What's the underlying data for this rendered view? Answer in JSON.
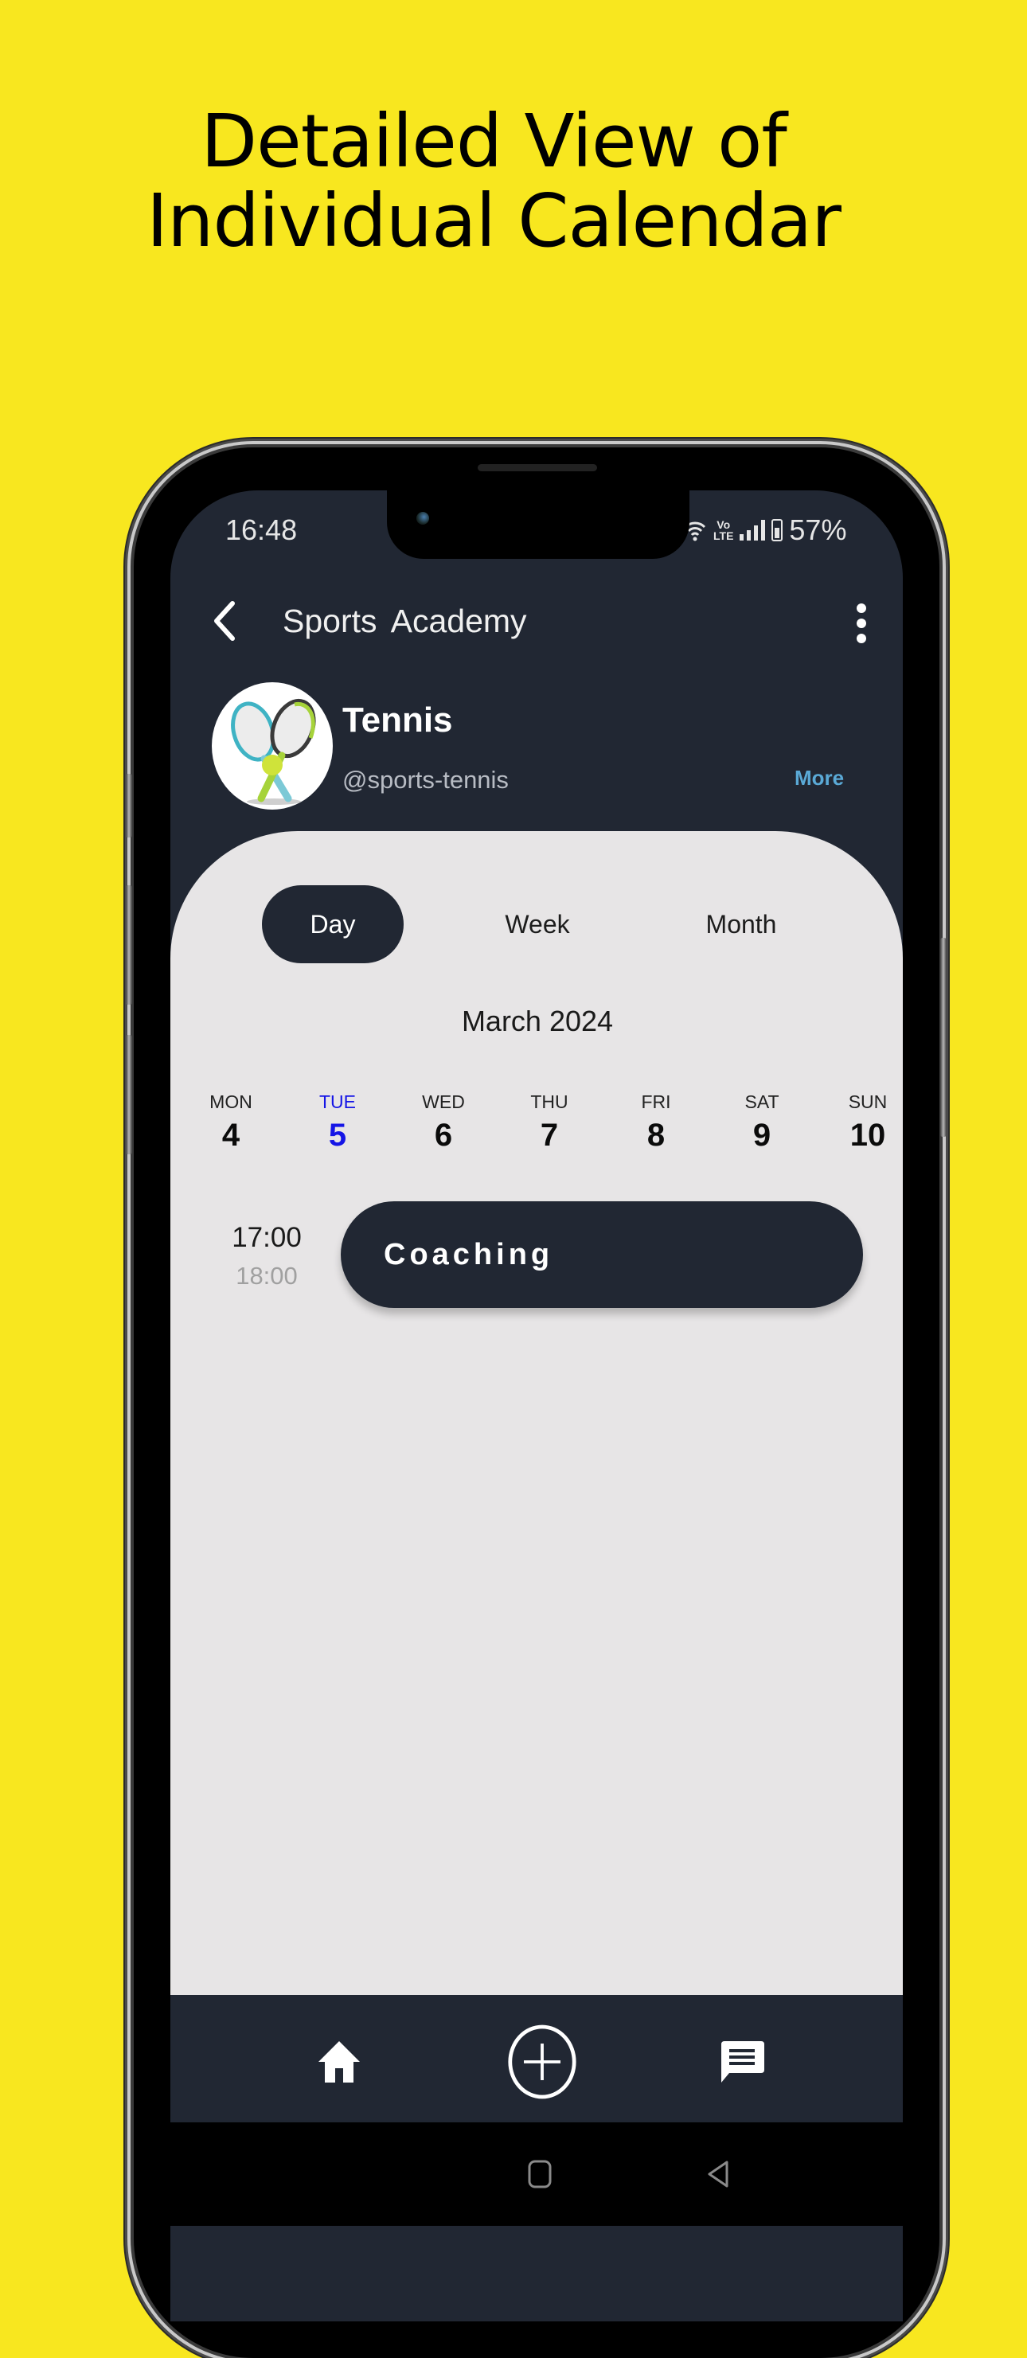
{
  "promo": {
    "title_line1": "Detailed View of",
    "title_line2": "Individual Calendar",
    "background_color": "#f8e71f"
  },
  "status_bar": {
    "time": "16:48",
    "network_label": "Vo LTE",
    "battery_percent": "57%",
    "icons": [
      "wifi-icon",
      "volte-icon",
      "signal-icon",
      "battery-icon"
    ]
  },
  "header": {
    "back_icon": "chevron-left-icon",
    "title": "Sports  Academy",
    "menu_icon": "more-vertical-icon"
  },
  "profile": {
    "avatar_icon": "tennis-rackets-icon",
    "name": "Tennis",
    "handle": "@sports-tennis",
    "more_label": "More",
    "more_color": "#5aa9d6"
  },
  "view_tabs": [
    {
      "label": "Day",
      "active": true
    },
    {
      "label": "Week",
      "active": false
    },
    {
      "label": "Month",
      "active": false
    }
  ],
  "calendar": {
    "month_label": "March 2024",
    "selected_color": "#1515e6",
    "days": [
      {
        "name": "MON",
        "num": "4",
        "selected": false
      },
      {
        "name": "TUE",
        "num": "5",
        "selected": true
      },
      {
        "name": "WED",
        "num": "6",
        "selected": false
      },
      {
        "name": "THU",
        "num": "7",
        "selected": false
      },
      {
        "name": "FRI",
        "num": "8",
        "selected": false
      },
      {
        "name": "SAT",
        "num": "9",
        "selected": false
      },
      {
        "name": "SUN",
        "num": "10",
        "selected": false
      }
    ],
    "events": [
      {
        "start": "17:00",
        "end": "18:00",
        "title": "Coaching"
      }
    ]
  },
  "bottom_nav": {
    "items": [
      {
        "icon": "home-icon",
        "name": "Home"
      },
      {
        "icon": "add-circle-icon",
        "name": "Add"
      },
      {
        "icon": "chat-icon",
        "name": "Messages"
      }
    ]
  },
  "system_nav": {
    "items": [
      {
        "icon": "home-square-icon"
      },
      {
        "icon": "back-triangle-icon"
      }
    ]
  },
  "theme": {
    "dark": "#212733",
    "card": "#e7e5e6"
  }
}
